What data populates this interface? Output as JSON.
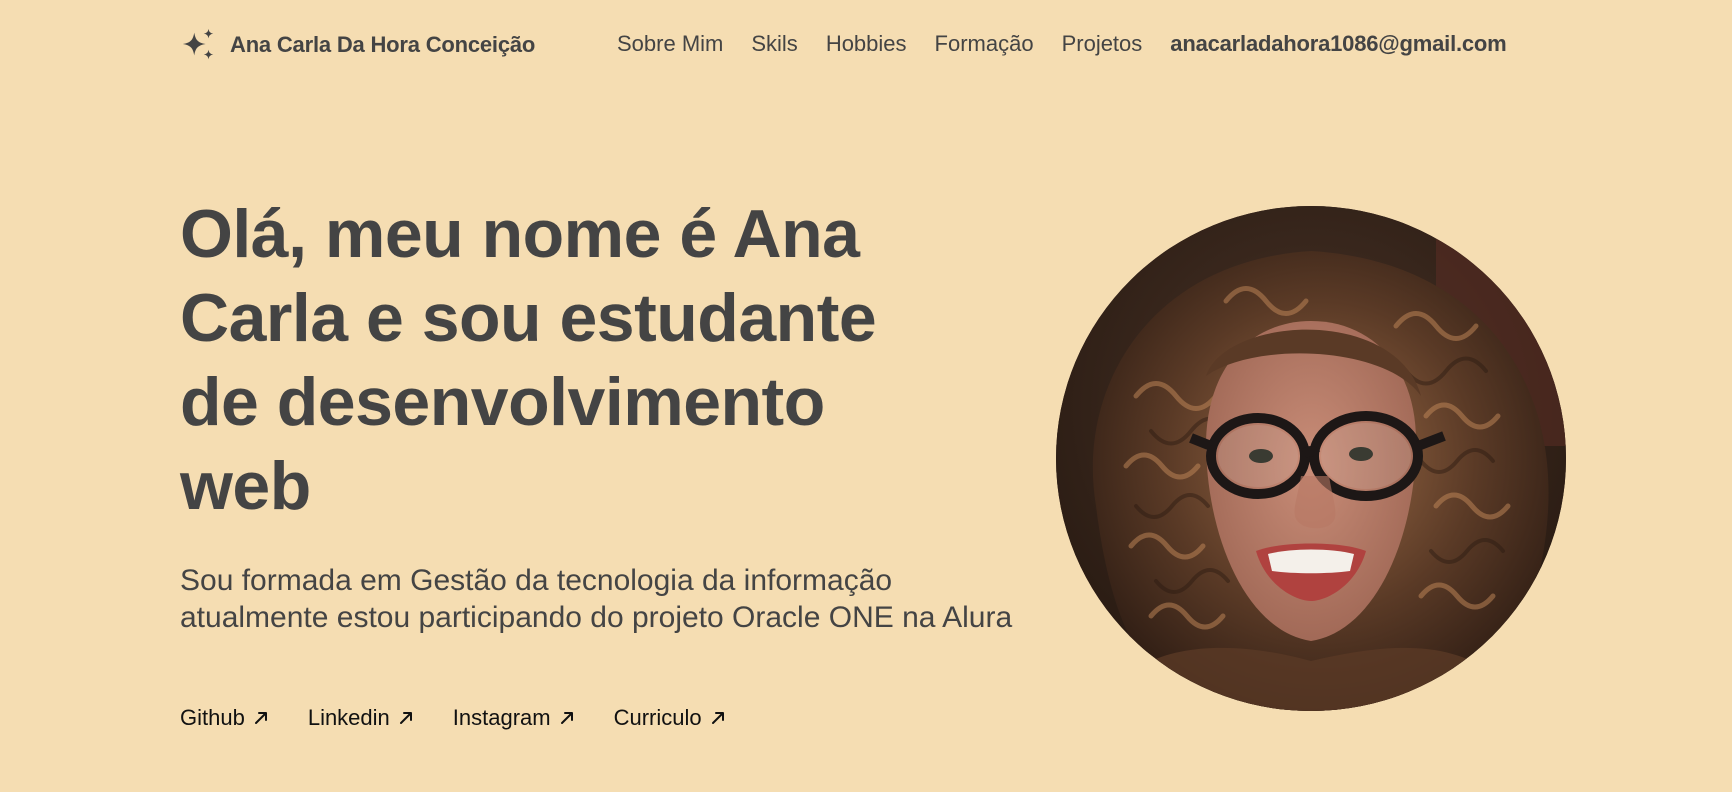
{
  "header": {
    "brand_name": "Ana Carla Da Hora Conceição",
    "brand_icon": "sparkles-icon",
    "nav": [
      {
        "label": "Sobre Mim"
      },
      {
        "label": "Skils"
      },
      {
        "label": "Hobbies"
      },
      {
        "label": "Formação"
      },
      {
        "label": "Projetos"
      }
    ],
    "email": "anacarladahora1086@gmail.com"
  },
  "hero": {
    "title": "Olá, meu nome é Ana Carla e sou estudante de desenvolvimento web",
    "description": "Sou formada em Gestão da tecnologia da informação atualmente estou participando do projeto Oracle ONE na Alura",
    "links": [
      {
        "label": "Github",
        "icon": "arrow-up-right-icon"
      },
      {
        "label": "Linkedin",
        "icon": "arrow-up-right-icon"
      },
      {
        "label": "Instagram",
        "icon": "arrow-up-right-icon"
      },
      {
        "label": "Curriculo",
        "icon": "arrow-up-right-icon"
      }
    ]
  },
  "colors": {
    "background": "#f5ddb2",
    "text": "#444444",
    "link_text": "#111111"
  }
}
